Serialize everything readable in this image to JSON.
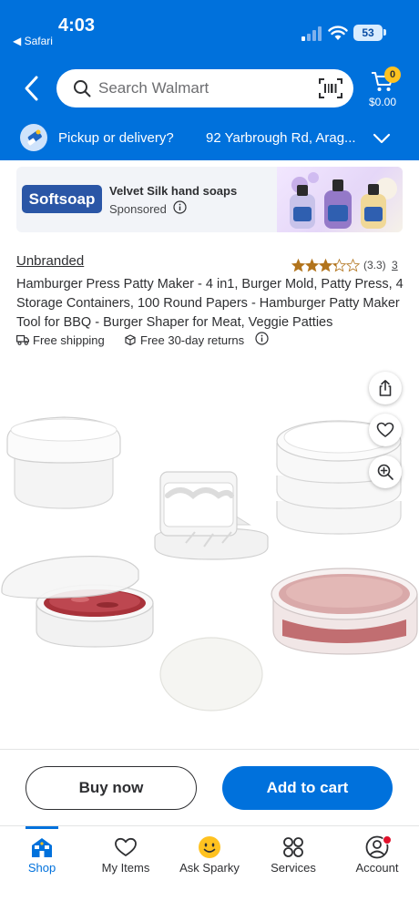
{
  "status_bar": {
    "time": "4:03",
    "back_app": "◀ Safari",
    "battery": "53"
  },
  "header": {
    "search": {
      "placeholder": "Search Walmart"
    },
    "cart": {
      "count": "0",
      "total": "$0.00"
    },
    "pickup": {
      "label": "Pickup or delivery?",
      "address": "92 Yarbrough Rd, Arag..."
    }
  },
  "ad": {
    "logo_text": "Softsoap",
    "title": "Velvet Silk hand soaps",
    "sponsored": "Sponsored"
  },
  "product": {
    "brand": "Unbranded",
    "rating": 3.3,
    "rating_text": "(3.3)",
    "review_count": "3",
    "title": "Hamburger Press Patty Maker - 4 in1, Burger Mold, Patty Press, 4 Storage Containers, 100 Round Papers - Hamburger Patty Maker Tool for BBQ - Burger Shaper for Meat, Veggie Patties",
    "features": [
      "Free shipping",
      "Free 30-day returns"
    ]
  },
  "actions": {
    "buy_now": "Buy now",
    "add_to_cart": "Add to cart"
  },
  "tabbar": {
    "items": [
      {
        "label": "Shop",
        "icon": "shop-icon"
      },
      {
        "label": "My Items",
        "icon": "heart-icon"
      },
      {
        "label": "Ask Sparky",
        "icon": "sparky-icon"
      },
      {
        "label": "Services",
        "icon": "services-icon"
      },
      {
        "label": "Account",
        "icon": "account-icon"
      }
    ],
    "active": "Shop"
  },
  "colors": {
    "brand_blue": "#0071dc",
    "badge_yellow": "#ffc220",
    "star": "#b2741d",
    "notification_red": "#e0112b"
  }
}
